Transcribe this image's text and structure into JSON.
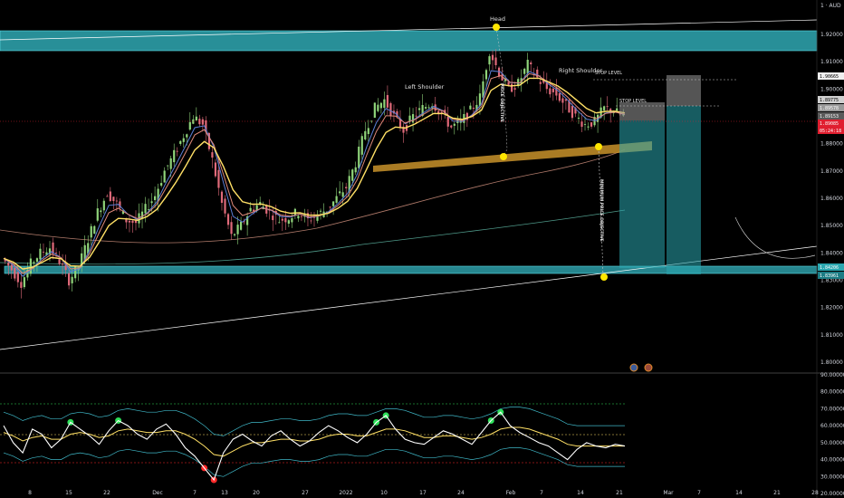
{
  "colors": {
    "background": "#000000",
    "zone": "#2fa8b3",
    "neckline": "#c8922a",
    "ema_fast": "#ffe066",
    "ema_mid": "#e08a7a",
    "ema_slow": "#5b7fd6",
    "ma_long": "#b07a6a",
    "ma_long2": "#4f9a8a",
    "bull_candle": "#8fd47a",
    "bear_candle": "#e06a7a",
    "target_box": "#2aa7b0",
    "stop_box": "#9a9a9a",
    "price_tag": "#e01e2f",
    "marker": "#ffe600",
    "osc_line": "#ffffff",
    "osc_signal": "#ffe066",
    "osc_band": "#3fb8c8",
    "osc_overbought": "#2ee05a",
    "osc_oversold": "#ff2a2a"
  },
  "annotations": {
    "head": "Head",
    "left_shoulder": "Left Shoulder",
    "right_shoulder": "Right Shoulder",
    "stop_level_1": "STOP LEVEL",
    "stop_level_2": "STOP LEVEL",
    "price_objective": "PRICE OBJECTIVE",
    "minimum_price_objective": "MINIMUM PRICE OBJECTIVE"
  },
  "price_tags": {
    "currency": "AUD",
    "p1": "1.90665",
    "p2": "1.89775",
    "p3": "1.89578",
    "p4": "1.89153",
    "last": "1.89085",
    "countdown": "05:24:18",
    "t1": "1.84206",
    "t2": "1.83961"
  },
  "chart_data": [
    {
      "type": "candlestick",
      "title": "",
      "xlabel": "",
      "ylabel": "",
      "y_ticks": [
        "1.92000",
        "1.91000",
        "1.90000",
        "1.89000",
        "1.88000",
        "1.87000",
        "1.86000",
        "1.85000",
        "1.84000",
        "1.83000",
        "1.82000",
        "1.81000",
        "1.80000"
      ],
      "x_ticks": [
        "8",
        "15",
        "22",
        "Dec",
        "7",
        "13",
        "20",
        "27",
        "2022",
        "10",
        "17",
        "24",
        "Feb",
        "7",
        "14",
        "21",
        "Mar",
        "7",
        "14",
        "21",
        "28"
      ],
      "ylim": [
        1.8,
        1.93
      ],
      "patterns": [
        "head and shoulders"
      ],
      "levels": {
        "resistance_zone": [
          1.915,
          1.922
        ],
        "support_zone": [
          1.8385,
          1.8405
        ],
        "head": 1.9225,
        "neckline_left": 1.878,
        "neckline_right": 1.8835,
        "stop_level": 1.897,
        "stop_level_high": 1.9065,
        "last_price": 1.89085,
        "target": 1.8365
      },
      "close_series": [
        1.838,
        1.834,
        1.829,
        1.836,
        1.84,
        1.842,
        1.837,
        1.83,
        1.835,
        1.845,
        1.855,
        1.862,
        1.858,
        1.852,
        1.851,
        1.856,
        1.861,
        1.87,
        1.876,
        1.883,
        1.89,
        1.887,
        1.874,
        1.858,
        1.846,
        1.85,
        1.856,
        1.858,
        1.855,
        1.852,
        1.853,
        1.855,
        1.852,
        1.854,
        1.856,
        1.86,
        1.864,
        1.873,
        1.885,
        1.893,
        1.896,
        1.89,
        1.885,
        1.89,
        1.893,
        1.895,
        1.891,
        1.886,
        1.888,
        1.892,
        1.897,
        1.914,
        1.906,
        1.9,
        1.902,
        1.909,
        1.904,
        1.9,
        1.898,
        1.894,
        1.89,
        1.887,
        1.888,
        1.893,
        1.892,
        1.89
      ]
    },
    {
      "type": "line",
      "title": "",
      "xlabel": "",
      "ylabel": "",
      "y_ticks": [
        "90.00000",
        "80.00000",
        "70.00000",
        "60.00000",
        "50.00000",
        "40.00000",
        "30.00000",
        "20.00000"
      ],
      "ylim": [
        20,
        90
      ],
      "levels": {
        "overbought": 70,
        "oversold": 30,
        "mid": 50
      },
      "series": [
        {
          "values": [
            60,
            50,
            44,
            58,
            55,
            47,
            52,
            62,
            58,
            54,
            49,
            57,
            63,
            60,
            55,
            52,
            58,
            61,
            55,
            47,
            42,
            35,
            28,
            44,
            52,
            55,
            51,
            48,
            54,
            57,
            52,
            48,
            51,
            56,
            60,
            57,
            53,
            50,
            55,
            62,
            66,
            58,
            52,
            50,
            49,
            53,
            57,
            55,
            52,
            49,
            56,
            63,
            68,
            60,
            56,
            53,
            50,
            48,
            44,
            40,
            46,
            50,
            48,
            47,
            49,
            48
          ]
        },
        {
          "values": [
            56,
            54,
            51,
            53,
            54,
            52,
            52,
            55,
            56,
            55,
            53,
            54,
            57,
            58,
            57,
            56,
            56,
            57,
            57,
            55,
            52,
            48,
            43,
            42,
            45,
            48,
            50,
            50,
            51,
            52,
            52,
            51,
            51,
            52,
            54,
            55,
            55,
            54,
            54,
            56,
            58,
            58,
            57,
            55,
            53,
            53,
            54,
            54,
            53,
            52,
            53,
            55,
            58,
            59,
            59,
            58,
            56,
            54,
            52,
            49,
            48,
            48,
            48,
            48,
            48,
            48
          ]
        }
      ]
    }
  ]
}
